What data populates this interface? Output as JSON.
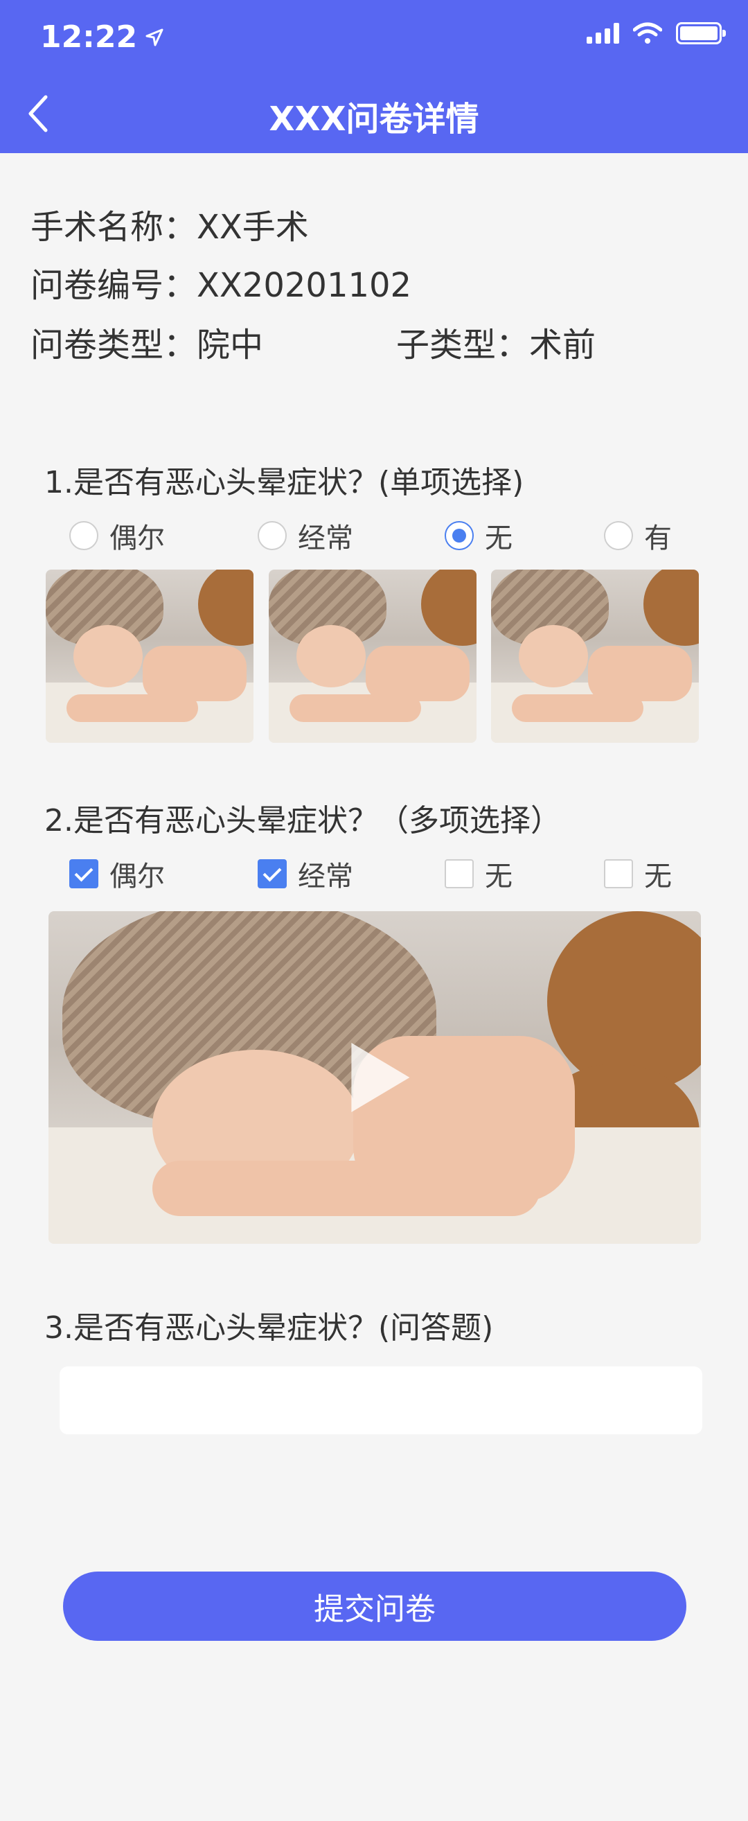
{
  "status_bar": {
    "time": "12:22"
  },
  "nav": {
    "title": "XXX问卷详情"
  },
  "info": {
    "surgery_label": "手术名称：",
    "surgery_value": "XX手术",
    "number_label": "问卷编号：",
    "number_value": "XX20201102",
    "type_label": "问卷类型：",
    "type_value": "院中",
    "subtype_label": "子类型：",
    "subtype_value": "术前"
  },
  "questions": [
    {
      "title": "1.是否有恶心头晕症状？(单项选择)",
      "options": [
        {
          "label": "偶尔",
          "checked": false
        },
        {
          "label": "经常",
          "checked": false
        },
        {
          "label": "无",
          "checked": true
        },
        {
          "label": "有",
          "checked": false
        }
      ]
    },
    {
      "title": "2.是否有恶心头晕症状？（多项选择）",
      "options": [
        {
          "label": "偶尔",
          "checked": true
        },
        {
          "label": "经常",
          "checked": true
        },
        {
          "label": "无",
          "checked": false
        },
        {
          "label": "无",
          "checked": false
        }
      ]
    },
    {
      "title": "3.是否有恶心头晕症状？(问答题)",
      "answer": ""
    }
  ],
  "submit_label": "提交问卷",
  "colors": {
    "primary": "#5867f2",
    "accent": "#4a7ff0",
    "background": "#f5f5f5"
  }
}
